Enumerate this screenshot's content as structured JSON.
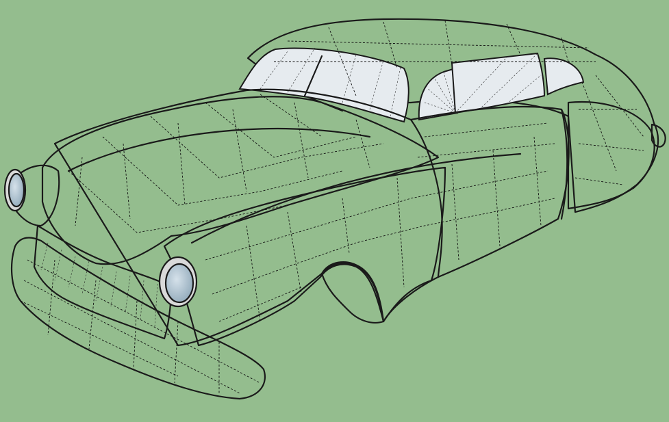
{
  "viewport": {
    "background_color": "#94bd8e",
    "model_fill": "#f3f3f3",
    "model_shadow": "#cfcfcf",
    "glass_color": "#e6ebef",
    "lamp_lens_color": "#a7bdcc",
    "edge_color": "#1a1a1a",
    "edge_style": "hidden-geometry-dashed"
  },
  "model": {
    "subject": "car-body-icon"
  }
}
